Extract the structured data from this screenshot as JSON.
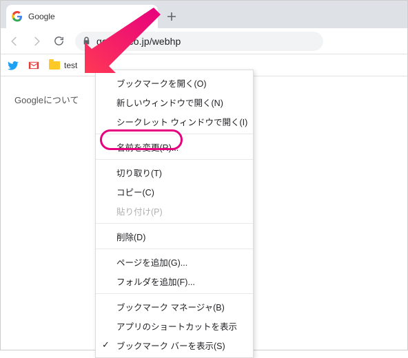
{
  "tab": {
    "title": "Google"
  },
  "omnibox": {
    "url": "google.co.jp/webhp"
  },
  "bookmarks": {
    "folder_label": "test"
  },
  "page": {
    "about_link": "Googleについて"
  },
  "menu": {
    "open_bookmark": "ブックマークを開く(O)",
    "open_new_window": "新しいウィンドウで開く(N)",
    "open_incognito": "シークレット ウィンドウで開く(I)",
    "rename": "名前を変更(R)...",
    "cut": "切り取り(T)",
    "copy": "コピー(C)",
    "paste": "貼り付け(P)",
    "delete": "削除(D)",
    "add_page": "ページを追加(G)...",
    "add_folder": "フォルダを追加(F)...",
    "bookmark_manager": "ブックマーク マネージャ(B)",
    "show_app_shortcuts": "アプリのショートカットを表示",
    "show_bookmarks_bar": "ブックマーク バーを表示(S)"
  }
}
